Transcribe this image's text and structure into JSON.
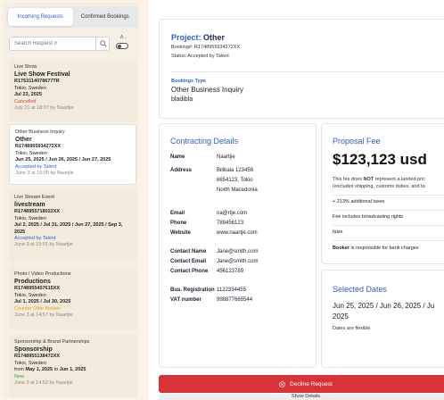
{
  "tabs": {
    "incoming": "Incoming Requests",
    "confirmed": "Confirmed Bookings"
  },
  "search": {
    "placeholder": "Search Request #"
  },
  "sort_label": "A→",
  "requests": [
    {
      "type": "Live Show",
      "title": "Live Show Festival",
      "ref": "R1753114078677TR",
      "location": "Tokio, Sweden",
      "dates": "Jul 23, 2025",
      "status": "Cancelled",
      "meta": "July 21 at 18:07 by Naartjie"
    },
    {
      "type": "Other Business Inquiry",
      "title": "Other",
      "ref": "R1748955934272XX",
      "location": "Tokio, Sweden",
      "dates": "Jun 25, 2025 / Jun 26, 2025 / Jun 27, 2025",
      "status": "Accepted by Talent",
      "meta": "June 3 at 15:05 by Naartjie"
    },
    {
      "type": "Live Stream Event",
      "title": "livestream",
      "ref": "R1748955718022XX",
      "location": "Tokio, Sweden",
      "dates": "Jul 2, 2025 / Jul 31, 2025 / Jun 27, 2025 / Sep 3, 2025",
      "status": "Accepted by Talent",
      "meta": "June 3 at 15:01 by Naartjie"
    },
    {
      "type": "Photo / Video Productions",
      "title": "Productions",
      "ref": "R1748955457615XX",
      "location": "Tokio, Sweden",
      "dates": "Jul 1, 2025 / Jul 30, 2025",
      "status": "Counter Offer Booker",
      "meta": "June 3 at 14:57 by Naartjie"
    },
    {
      "type": "Sponsorship & Brand Partnerships",
      "title": "Sponsorship",
      "ref": "R1748955138472XX",
      "location": "Tokio, Sweden",
      "dates_from": "from",
      "dates_a": "May 1, 2025",
      "dates_to": "to",
      "dates_b": "Jun 1, 2025",
      "status": "New",
      "meta": "June 3 at 14:52 by Naartjie"
    }
  ],
  "project": {
    "label": "Project:",
    "name": "Other",
    "booking": "Booking#: R1748955934272XX",
    "status": "Status: Accepted by Talent",
    "bookings_type_label": "Bookings Type",
    "bookings_type": "Other Business Inquiry",
    "description": "bladibla"
  },
  "contracting": {
    "title": "Contracting Details",
    "name_k": "Name",
    "name_v": "Naartjie",
    "address_k": "Address",
    "address_1": "Bilibala 123456",
    "address_2": "6654123, Tokio",
    "address_3": "North Macedonia",
    "email_k": "Email",
    "email_v": "na@rtje.com",
    "phone_k": "Phone",
    "phone_v": "789456123",
    "website_k": "Website",
    "website_v": "www.naartje.com",
    "cname_k": "Contact Name",
    "cname_v": "Jane@smith.com",
    "cemail_k": "Contact Email",
    "cemail_v": "Jane@smith.com",
    "cphone_k": "Contact Phone",
    "cphone_v": "456123789",
    "busreg_k": "Bus. Registration",
    "busreg_v": "1122334455",
    "vat_k": "VAT number",
    "vat_v": "998877665544"
  },
  "proposal": {
    "title": "Proposal Fee",
    "amount": "$123,123 usd",
    "note_a": "This fee does ",
    "note_not": "NOT",
    "note_b": " represent a landed pric",
    "note_c": "(excludes shipping, customs duties, and ta",
    "taxes": "+ 213% additional taxes",
    "rights": "Fee includes broadcasting rights",
    "flag": "false",
    "bank_b": "Booker",
    "bank": " is responsible for bank charges"
  },
  "selected": {
    "title": "Selected Dates",
    "dates_line1": "Jun 25, 2025 / Jun 26, 2025 / Ju",
    "dates_line2": "2025",
    "flex": "Dates are flexible"
  },
  "actions": {
    "decline": "Decline Request",
    "details": "Show Details"
  },
  "colors": {
    "accent": "#2f5fd0",
    "decline": "#d9333a",
    "cancel": "#e03b3b",
    "new": "#28a745",
    "counter": "#e49a1a"
  }
}
